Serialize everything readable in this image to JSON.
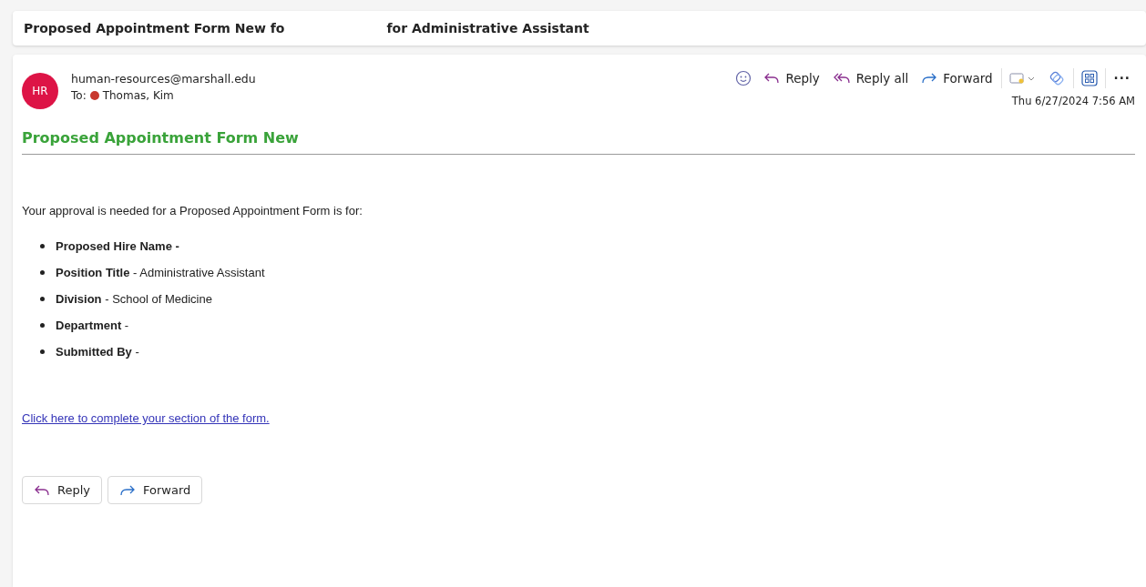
{
  "subject": {
    "parts": [
      "Proposed Appointment Form New fo",
      "for Administrative Assistant"
    ]
  },
  "message": {
    "avatar_initials": "HR",
    "sender": "human-resources@marshall.edu",
    "to_label": "To:",
    "recipient": {
      "name": "Thomas, Kim",
      "color": "#c8372d"
    },
    "actions": [
      {
        "kind": "emoji"
      },
      {
        "kind": "reply",
        "label": "Reply"
      },
      {
        "kind": "reply_all",
        "label": "Reply all"
      },
      {
        "kind": "forward",
        "label": "Forward"
      },
      {
        "kind": "divider"
      },
      {
        "kind": "tag"
      },
      {
        "kind": "sticker"
      },
      {
        "kind": "divider"
      },
      {
        "kind": "apps"
      },
      {
        "kind": "divider"
      },
      {
        "kind": "more",
        "label": "···"
      }
    ],
    "date": "Thu 6/27/2024 7:56 AM",
    "heading": "Proposed Appointment Form New",
    "intro": "Your approval is needed for a Proposed Appointment Form is for:",
    "fields": [
      "**Proposed Hire Name -**",
      "**Position Title** - Administrative Assistant",
      "**Division** - School of Medicine",
      "**Department** -",
      "**Submitted By** -"
    ],
    "link": "Click here to complete your section of the form.",
    "footer_buttons": [
      {
        "kind": "reply",
        "label": "Reply"
      },
      {
        "kind": "forward",
        "label": "Forward"
      }
    ]
  }
}
